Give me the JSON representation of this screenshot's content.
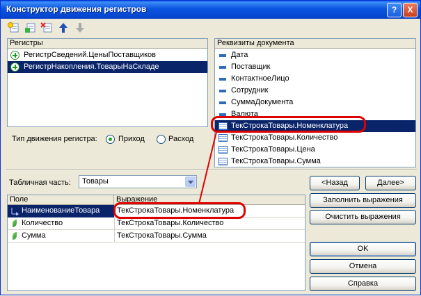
{
  "window": {
    "title": "Конструктор движения регистров",
    "help_glyph": "?",
    "close_glyph": "X"
  },
  "toolbar": {
    "icons": [
      "add-row-icon",
      "add-child-icon",
      "delete-row-icon",
      "move-up-icon",
      "move-down-icon"
    ]
  },
  "registers": {
    "header": "Регистры",
    "items": [
      {
        "label": "РегистрСведений.ЦеныПоставщиков",
        "selected": false
      },
      {
        "label": "РегистрНакопления.ТоварыНаСкладе",
        "selected": true
      }
    ]
  },
  "attributes": {
    "header": "Реквизиты документа",
    "items": [
      {
        "label": "Дата",
        "kind": "attr"
      },
      {
        "label": "Поставщик",
        "kind": "attr"
      },
      {
        "label": "КонтактноеЛицо",
        "kind": "attr"
      },
      {
        "label": "Сотрудник",
        "kind": "attr"
      },
      {
        "label": "СуммаДокумента",
        "kind": "attr"
      },
      {
        "label": "Валюта",
        "kind": "attr"
      },
      {
        "label": "ТекСтрокаТовары.Номенклатура",
        "kind": "tab",
        "selected": true
      },
      {
        "label": "ТекСтрокаТовары.Количество",
        "kind": "tab"
      },
      {
        "label": "ТекСтрокаТовары.Цена",
        "kind": "tab"
      },
      {
        "label": "ТекСтрокаТовары.Сумма",
        "kind": "tab"
      }
    ]
  },
  "movement": {
    "label": "Тип движения регистра:",
    "options": [
      {
        "label": "Приход",
        "checked": true
      },
      {
        "label": "Расход",
        "checked": false
      }
    ]
  },
  "tabular": {
    "label": "Табличная часть:",
    "value": "Товары"
  },
  "grid": {
    "columns": [
      "Поле",
      "Выражение"
    ],
    "rows": [
      {
        "field": "НаименованиеТовара",
        "expr": "ТекСтрокаТовары.Номенклатура",
        "selected": true
      },
      {
        "field": "Количество",
        "expr": "ТекСтрокаТовары.Количество",
        "selected": false
      },
      {
        "field": "Сумма",
        "expr": "ТекСтрокаТовары.Сумма",
        "selected": false
      }
    ]
  },
  "buttons": {
    "back": "<Назад",
    "next": "Далее>",
    "fill": "Заполнить выражения",
    "clear": "Очистить выражения",
    "ok": "OK",
    "cancel": "Отмена",
    "help": "Справка"
  },
  "colors": {
    "annotation": "#e00000",
    "selection": "#0a246a",
    "titlebar": "#0a54e0"
  }
}
